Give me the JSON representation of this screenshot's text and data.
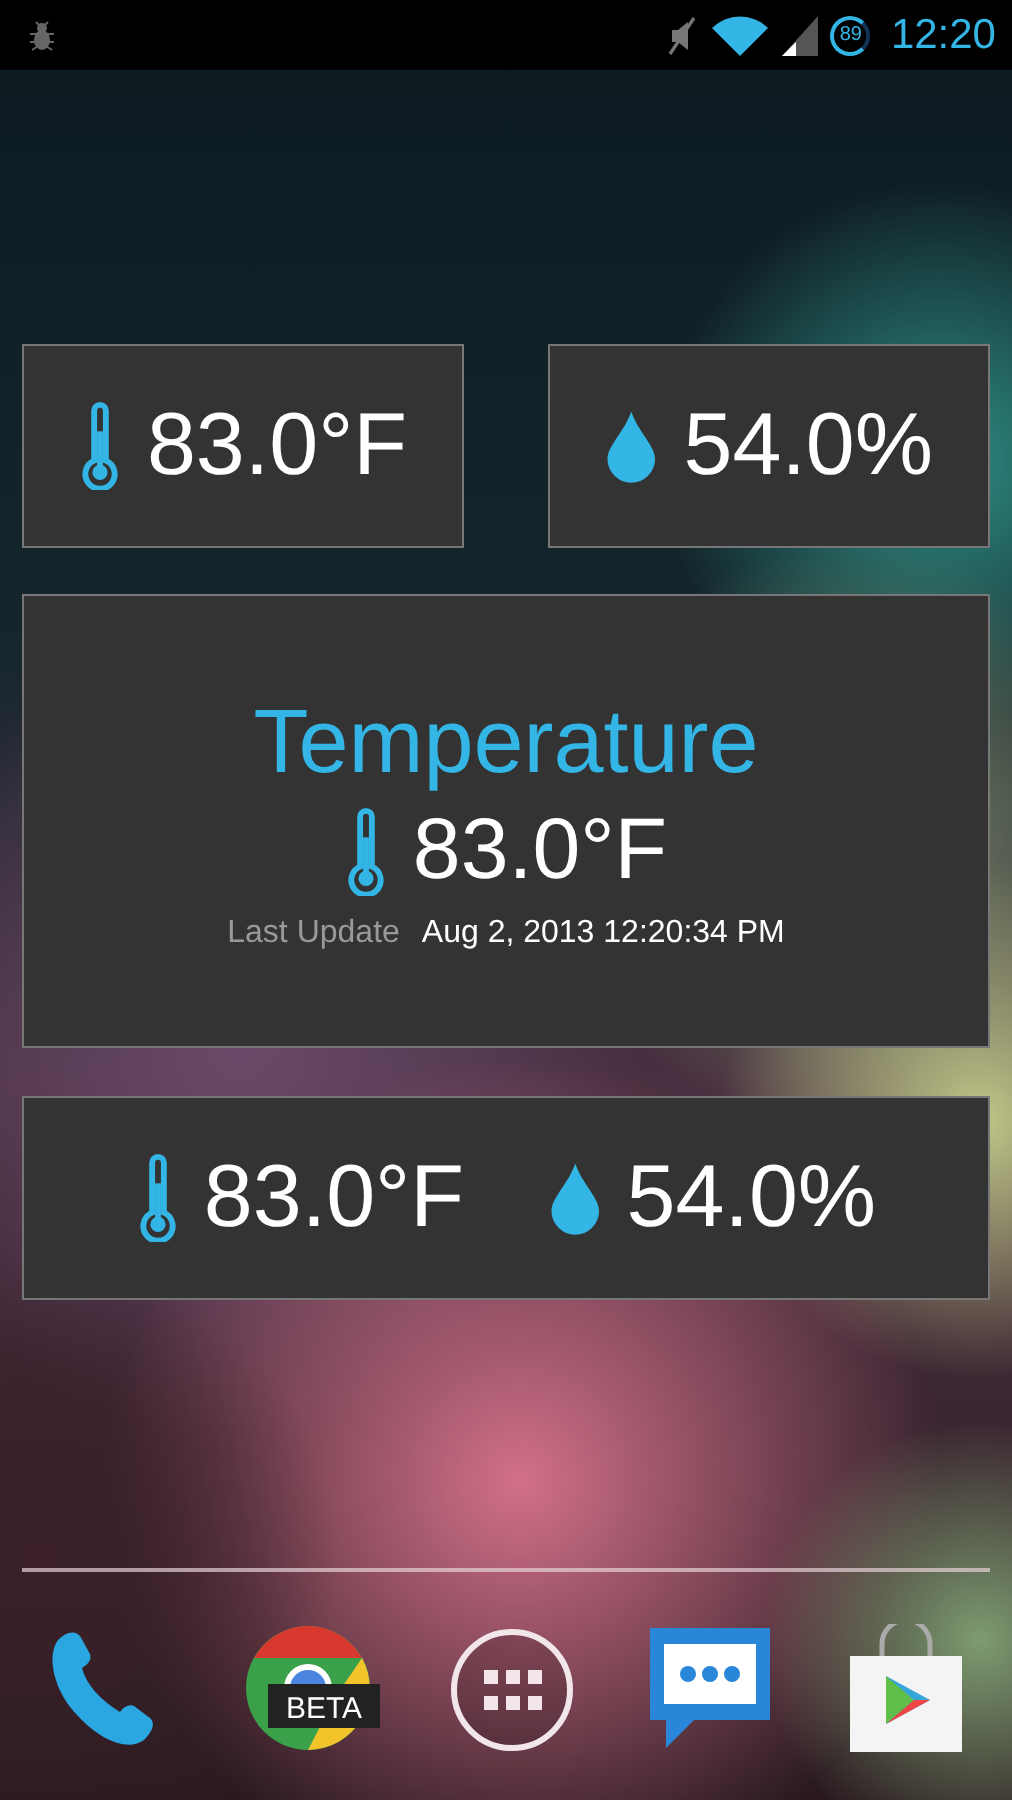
{
  "status_bar": {
    "battery": "89",
    "time": "12:20"
  },
  "small_widgets": [
    {
      "kind": "temperature",
      "value": "83.0°F"
    },
    {
      "kind": "humidity",
      "value": "54.0%"
    }
  ],
  "detail_widget": {
    "title": "Temperature",
    "kind": "temperature",
    "value": "83.0°F",
    "last_update_label": "Last Update",
    "last_update": "Aug 2, 2013 12:20:34 PM"
  },
  "combined_widget": {
    "readings": [
      {
        "kind": "temperature",
        "value": "83.0°F"
      },
      {
        "kind": "humidity",
        "value": "54.0%"
      }
    ]
  },
  "dock": {
    "apps": [
      {
        "kind": "phone"
      },
      {
        "kind": "browser",
        "badge": "BETA"
      },
      {
        "kind": "apps"
      },
      {
        "kind": "messaging"
      },
      {
        "kind": "store"
      }
    ]
  }
}
